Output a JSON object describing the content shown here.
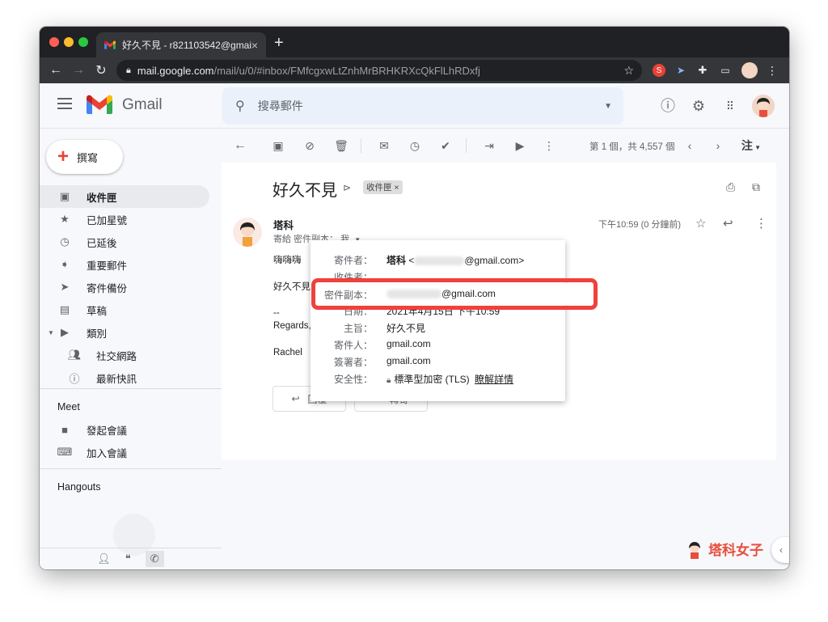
{
  "browser": {
    "tab_title": "好久不見 - r821103542@gmail.",
    "tab_close": "×",
    "new_tab": "+",
    "url_host": "mail.google.com",
    "url_path": "/mail/u/0/#inbox/FMfcgxwLtZnhMrBRHKRXcQkFlLhRDxfj",
    "ext_s_label": "S"
  },
  "header": {
    "brand": "Gmail",
    "search_placeholder": "搜尋郵件"
  },
  "sidebar": {
    "compose_label": "撰寫",
    "items": [
      {
        "label": "收件匣",
        "icon": "inbox-icon"
      },
      {
        "label": "已加星號",
        "icon": "star-icon"
      },
      {
        "label": "已延後",
        "icon": "clock-icon"
      },
      {
        "label": "重要郵件",
        "icon": "important-icon"
      },
      {
        "label": "寄件備份",
        "icon": "send-icon"
      },
      {
        "label": "草稿",
        "icon": "draft-icon"
      },
      {
        "label": "類別",
        "icon": "label-icon"
      },
      {
        "label": "社交網路",
        "icon": "people-icon"
      },
      {
        "label": "最新快訊",
        "icon": "info-icon"
      }
    ],
    "meet_heading": "Meet",
    "meet_items": [
      {
        "label": "發起會議",
        "icon": "video-icon"
      },
      {
        "label": "加入會議",
        "icon": "keyboard-icon"
      }
    ],
    "hangouts_heading": "Hangouts"
  },
  "toolbar": {
    "pager": "第 1 個，共 4,557 個",
    "lang": "注"
  },
  "message": {
    "subject": "好久不見",
    "label_chip": "收件匣",
    "label_chip_x": "×",
    "sender_name": "塔科",
    "to_line": "寄給 密件副本： 我",
    "time": "下午10:59 (0 分鐘前)",
    "body_line1": "嗨嗨嗨",
    "body_line2": "好久不見，最近在嗎",
    "body_sig_dash": "--",
    "body_sig_regards": "Regards,",
    "body_sig_name": "Rachel",
    "reply_label": "回覆",
    "forward_label": "轉寄"
  },
  "details_popup": {
    "rows": [
      {
        "label": "寄件者：",
        "value_name": "塔科",
        "value_email": "@gmail.com>"
      },
      {
        "label": "收件者：",
        "value": ""
      },
      {
        "label": "密件副本：",
        "value_email": "@gmail.com"
      },
      {
        "label": "日期：",
        "value": "2021年4月15日 下午10:59"
      },
      {
        "label": "主旨：",
        "value": "好久不見"
      },
      {
        "label": "寄件人：",
        "value": "gmail.com"
      },
      {
        "label": "簽署者：",
        "value": "gmail.com"
      },
      {
        "label": "安全性：",
        "value": "標準型加密 (TLS)",
        "link": "瞭解詳情"
      }
    ]
  },
  "watermark": "塔科女子",
  "colors": {
    "highlight": "#f0413b",
    "sidebar_active": "#e8eaed",
    "search_bg": "#eaf1fb"
  }
}
